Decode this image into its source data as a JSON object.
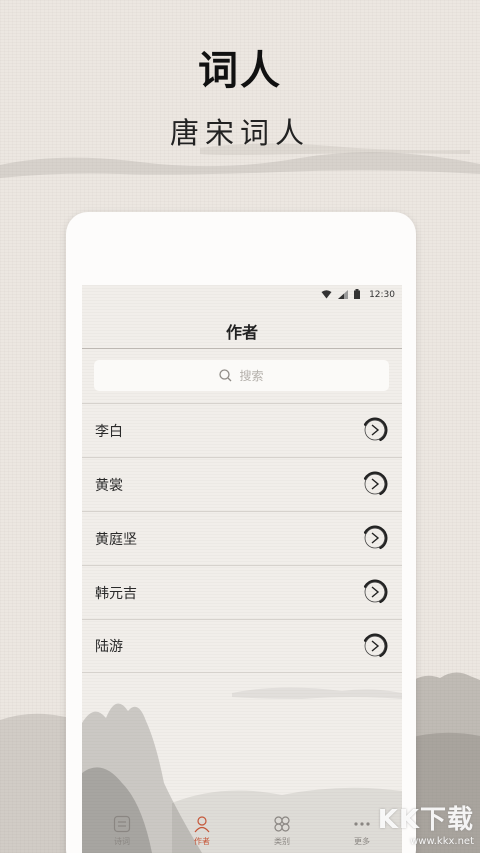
{
  "promo": {
    "headline": "词人",
    "subline": "唐宋词人"
  },
  "status_bar": {
    "time": "12:30",
    "icons": [
      "wifi-icon",
      "signal-icon",
      "battery-icon"
    ]
  },
  "app_bar": {
    "title": "作者"
  },
  "search": {
    "placeholder": "搜索"
  },
  "authors": [
    {
      "name": "李白"
    },
    {
      "name": "黄裳"
    },
    {
      "name": "黄庭坚"
    },
    {
      "name": "韩元吉"
    },
    {
      "name": "陆游"
    }
  ],
  "tab_bar": {
    "tabs": [
      {
        "label": "诗词",
        "icon": "book-icon",
        "active": false
      },
      {
        "label": "作者",
        "icon": "person-icon",
        "active": true
      },
      {
        "label": "类别",
        "icon": "category-icon",
        "active": false
      },
      {
        "label": "更多",
        "icon": "more-icon",
        "active": false
      }
    ]
  },
  "watermark": {
    "brand": "KK下载",
    "url": "www.kkx.net"
  },
  "colors": {
    "background": "#ece7e1",
    "active_tab": "#c55638",
    "text": "#1a1a1a"
  }
}
